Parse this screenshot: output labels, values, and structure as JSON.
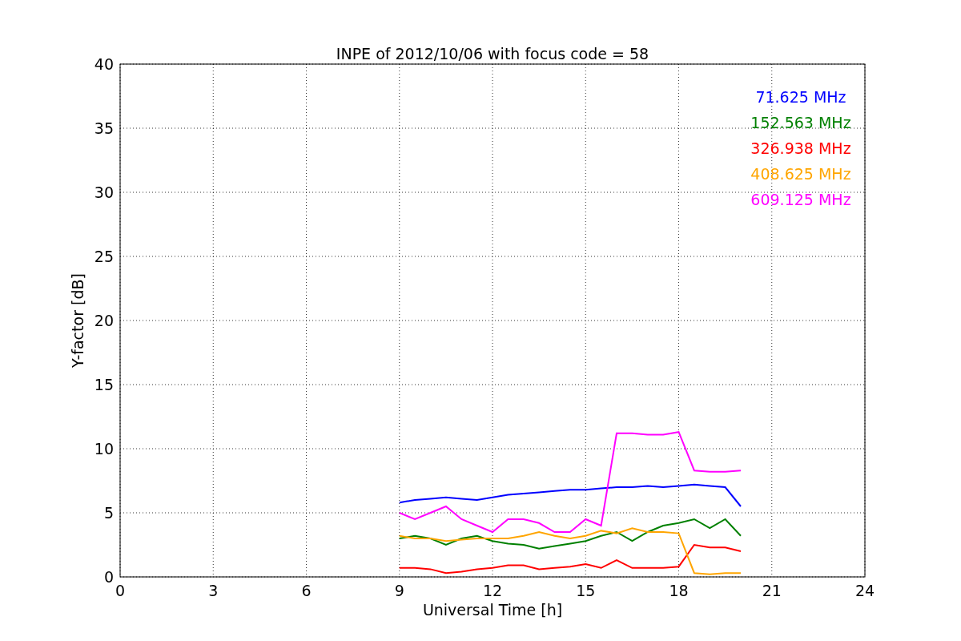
{
  "chart_data": {
    "type": "line",
    "title": "INPE of 2012/10/06 with focus code = 58",
    "xlabel": "Universal Time [h]",
    "ylabel": "Y-factor [dB]",
    "x": [
      9,
      9.5,
      10,
      10.5,
      11,
      11.5,
      12,
      12.5,
      13,
      13.5,
      14,
      14.5,
      15,
      15.5,
      16,
      16.5,
      17,
      17.5,
      18,
      18.5,
      19,
      19.5,
      20
    ],
    "series": [
      {
        "name": "71.625 MHz",
        "color": "#0000ff",
        "values": [
          5.8,
          6,
          6.1,
          6.2,
          6.1,
          6,
          6.2,
          6.4,
          6.5,
          6.6,
          6.7,
          6.8,
          6.8,
          6.9,
          7,
          7,
          7.1,
          7,
          7.1,
          7.2,
          7.1,
          7,
          5.5
        ]
      },
      {
        "name": "152.563 MHz",
        "color": "#008000",
        "values": [
          3,
          3.2,
          3,
          2.5,
          3,
          3.2,
          2.8,
          2.6,
          2.5,
          2.2,
          2.4,
          2.6,
          2.8,
          3.2,
          3.5,
          2.8,
          3.5,
          4,
          4.2,
          4.5,
          3.8,
          4.5,
          3.2
        ]
      },
      {
        "name": "326.938 MHz",
        "color": "#ff0000",
        "values": [
          0.7,
          0.7,
          0.6,
          0.3,
          0.4,
          0.6,
          0.7,
          0.9,
          0.9,
          0.6,
          0.7,
          0.8,
          1,
          0.7,
          1.3,
          0.7,
          0.7,
          0.7,
          0.8,
          2.5,
          2.3,
          2.3,
          2
        ]
      },
      {
        "name": "408.625 MHz",
        "color": "#ffa500",
        "values": [
          3.2,
          3,
          3,
          2.8,
          2.9,
          3,
          3,
          3,
          3.2,
          3.5,
          3.2,
          3,
          3.2,
          3.6,
          3.4,
          3.8,
          3.5,
          3.5,
          3.4,
          0.3,
          0.2,
          0.3,
          0.3
        ]
      },
      {
        "name": "609.125 MHz",
        "color": "#ff00ff",
        "values": [
          5,
          4.5,
          5,
          5.5,
          4.5,
          4,
          3.5,
          4.5,
          4.5,
          4.2,
          3.5,
          3.5,
          4.5,
          4,
          11.2,
          11.2,
          11.1,
          11.1,
          11.3,
          8.3,
          8.2,
          8.2,
          8.3
        ]
      }
    ],
    "grid": true,
    "xlim": [
      0,
      24
    ],
    "ylim": [
      0,
      40
    ],
    "xticks": [
      0,
      3,
      6,
      9,
      12,
      15,
      18,
      21,
      24
    ],
    "yticks": [
      0,
      5,
      10,
      15,
      20,
      25,
      30,
      35,
      40
    ]
  }
}
